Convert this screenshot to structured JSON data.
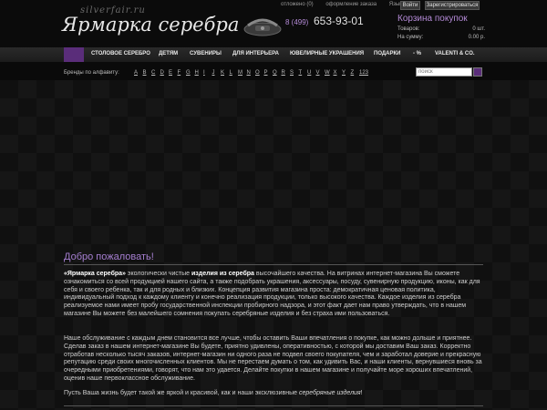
{
  "header": {
    "logo_sub": "silverfair.ru",
    "logo_main": "Ярмарка серебра",
    "phone_prefix": "8 (499)",
    "phone_number": "653-93-01",
    "topnav": {
      "deferred": "отложено (0)",
      "checkout": "оформление заказа",
      "lang": "Язык"
    },
    "login_label": "Войти",
    "register_label": "Зарегистрироваться",
    "cart": {
      "title": "Корзина покупок",
      "items_label": "Товаров:",
      "items_value": "0 шт.",
      "sum_label": "На сумму:",
      "sum_value": "0.00 р."
    }
  },
  "menu": {
    "items": [
      "СТОЛОВОЕ СЕРЕБРО",
      "ДЕТЯМ",
      "СУВЕНИРЫ",
      "ДЛЯ ИНТЕРЬЕРА",
      "ЮВЕЛИРНЫЕ УКРАШЕНИЯ",
      "ПОДАРКИ",
      "- %",
      "VALENTI & CO."
    ]
  },
  "brands": {
    "label": "Бренды по алфавиту:",
    "letters": [
      "A",
      "B",
      "C",
      "D",
      "E",
      "F",
      "G",
      "H",
      "I",
      "J",
      "K",
      "L",
      "M",
      "N",
      "O",
      "P",
      "Q",
      "R",
      "S",
      "T",
      "U",
      "V",
      "W",
      "X",
      "Y",
      "Z",
      "123"
    ]
  },
  "search": {
    "placeholder": "поиск"
  },
  "content": {
    "welcome": "Добро пожаловать!",
    "p1_b1": "«Ярмарка серебра»",
    "p1_t1": " экологически чистые ",
    "p1_b2": "изделия из серебра",
    "p1_t2": " высочайшего качества. На витринах интернет-магазина Вы сможете ознакомиться со всей продукцией нашего сайта, а также подобрать украшения, аксессуары, посуду, сувенирную продукцию, иконы, как для себя и своего ребенка, так и для родных и близких. Концепция развития магазина проста: демократичная ценовая политика, индивидуальный подход к каждому клиенту и конечно реализация продукции, только высокого качества. Каждое изделия из серебра реализуемое нами имеет пробу государственной инспекции пробирного надзора, и этот факт дает нам право утверждать, что в нашем магазине Вы можете без малейшего сомнения покупать серебряные изделия и без страха ими пользоваться.",
    "p2": "Наше обслуживание с каждым днем становится все лучше, чтобы оставить Ваши впечатления о покупке, как можно дольше и приятнее. Сделав заказ в нашем интернет-магазине Вы будете, приятно удивлены, оперативностью, с которой мы доставим Ваш заказ. Корректно отработав несколько тысяч заказов, интернет-магазин ни одного раза не подвел своего покупателя, чем и заработал доверие и прекрасную репутацию среди своих многочисленных клиентов. Мы не перестаем думать о том, как удивить Вас, и наши клиенты, вернувшиеся вновь за очередными приобретениями, говорят, что нам это удается. Делайте покупки в нашем магазине и получайте море хороших впечатлений, оценив наше первоклассное обслуживание.",
    "p3_t": "Пусть Ваша жизнь будет такой же яркой и красивой, как и наши эксклюзивные ",
    "p3_i": "серебряные изделия",
    "p3_end": "!"
  },
  "colors": {
    "accent": "#a57ed0",
    "menu_accent": "#5a2d7a",
    "background": "#0a0a0a"
  }
}
